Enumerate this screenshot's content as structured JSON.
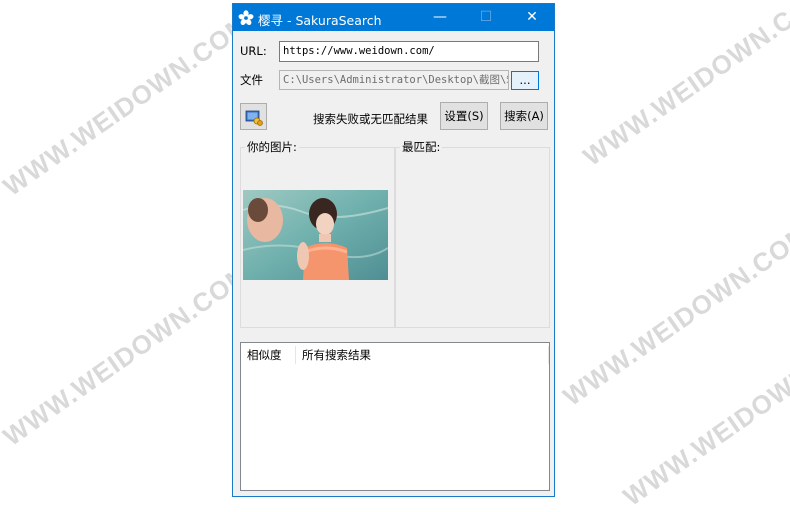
{
  "window": {
    "title": "樱寻 - SakuraSearch",
    "minimize_glyph": "—",
    "maximize_glyph": "☐",
    "close_glyph": "✕"
  },
  "form": {
    "url_label": "URL:",
    "url_value": "https://www.weidown.com/",
    "file_label": "文件",
    "file_value": "C:\\Users\\Administrator\\Desktop\\截图\\筑",
    "browse_label": "..."
  },
  "actions": {
    "status_text": "搜索失败或无匹配结果",
    "settings_label": "设置(S)",
    "search_label": "搜索(A)"
  },
  "panels": {
    "your_image_label": "你的图片:",
    "best_match_label": "最匹配:"
  },
  "results": {
    "columns": [
      "相似度",
      "所有搜索结果"
    ]
  },
  "watermark": "WWW.WEIDOWN.COM",
  "colors": {
    "titlebar": "#0078d7",
    "window_bg": "#f0f0f0",
    "focus_border": "#0078d7"
  }
}
